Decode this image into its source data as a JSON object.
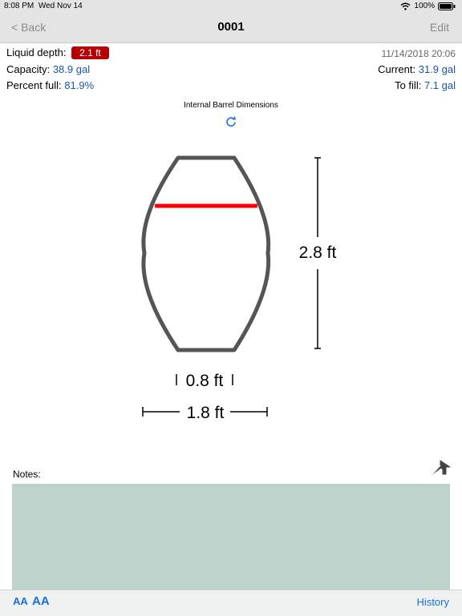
{
  "status_bar": {
    "time": "8:08 PM",
    "date": "Wed Nov 14",
    "battery": "100%",
    "icons": [
      "wifi-icon",
      "battery-icon"
    ]
  },
  "nav": {
    "back": "< Back",
    "title": "0001",
    "edit": "Edit"
  },
  "info": {
    "liquid_depth_label": "Liquid depth:",
    "liquid_depth_value": "2.1 ft",
    "timestamp": "11/14/2018 20:06",
    "capacity_label": "Capacity:",
    "capacity_value": "38.9 gal",
    "current_label": "Current:",
    "current_value": "31.9 gal",
    "percent_label": "Percent full:",
    "percent_value": "81.9%",
    "tofill_label": "To fill:",
    "tofill_value": "7.1 gal"
  },
  "diagram": {
    "title": "Internal Barrel Dimensions",
    "height_label": "2.8 ft",
    "head_diameter_label": "0.8 ft",
    "bilge_diameter_label": "1.8 ft",
    "fill_fraction": 0.75,
    "refresh_icon": "refresh-icon"
  },
  "notes": {
    "label": "Notes:",
    "icon": "share-arrow-icon",
    "text": ""
  },
  "toolbar": {
    "font_smaller": "AA",
    "font_larger": "AA",
    "history": "History"
  },
  "colors": {
    "accent_blue": "#1a6fe0",
    "value_blue": "#1a56a8",
    "badge_red": "#b30000",
    "fill_line_red": "#ff0000",
    "notes_bg": "#bcd3cb"
  }
}
